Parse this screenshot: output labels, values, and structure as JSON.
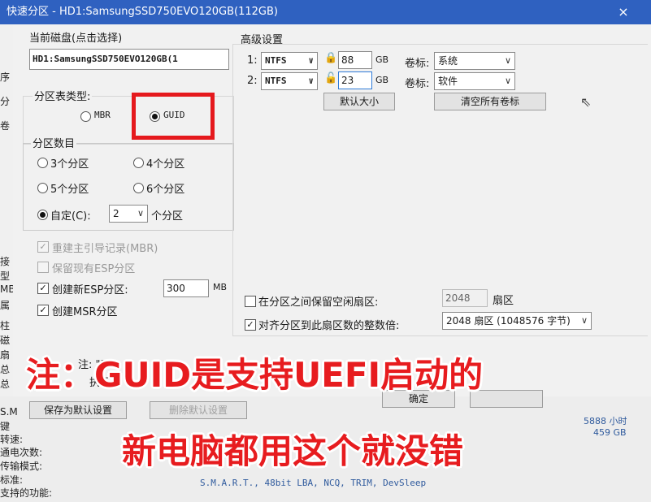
{
  "window": {
    "title": "快速分区 - HD1:SamsungSSD750EVO120GB(112GB)",
    "close_glyph": "×"
  },
  "disk": {
    "label": "当前磁盘(点击选择)",
    "value": "HD1:SamsungSSD750EVO120GB(1"
  },
  "partition_table": {
    "label": "分区表类型:",
    "options": [
      "MBR",
      "GUID"
    ],
    "selected": "GUID"
  },
  "partition_count": {
    "label": "分区数目",
    "options": [
      "3个分区",
      "4个分区",
      "5个分区",
      "6个分区"
    ],
    "custom_label": "自定(C):",
    "custom_value": "2",
    "custom_suffix": "个分区",
    "selected": "custom"
  },
  "options": {
    "rebuild_mbr": "重建主引导记录(MBR)",
    "keep_esp": "保留现有ESP分区",
    "create_esp": "创建新ESP分区:",
    "esp_size": "300",
    "esp_unit": "MB",
    "create_msr": "创建MSR分区"
  },
  "advanced": {
    "label": "高级设置",
    "partitions": [
      {
        "index": "1:",
        "fs": "NTFS",
        "size": "88",
        "unit": "GB",
        "vol_label": "卷标:",
        "volume": "系统"
      },
      {
        "index": "2:",
        "fs": "NTFS",
        "size": "23",
        "unit": "GB",
        "vol_label": "卷标:",
        "volume": "软件"
      }
    ],
    "default_size_button": "默认大小",
    "clear_labels_button": "清空所有卷标",
    "keep_free_label": "在分区之间保留空闲扇区:",
    "keep_free_value": "2048",
    "sector_unit": "扇区",
    "align_label": "对齐分区到此扇区数的整数倍:",
    "align_value": "2048 扇区 (1048576 字节)"
  },
  "footer": {
    "note_fragment": "注: \"3、",
    "note_fragment2": "执行",
    "save_default_button": "保存为默认设置",
    "delete_default_button": "删除默认设置",
    "ok_button": "确定"
  },
  "background": {
    "left_fragments": [
      "序",
      "分",
      "卷",
      "接",
      "型",
      "MB",
      "属",
      "柱",
      "磁",
      "扇",
      "总",
      "总",
      "S.M",
      "键",
      "转速:",
      "通电次数:",
      "传输模式:",
      "标准:",
      "支持的功能:"
    ],
    "hours": "5888 小时",
    "capacity": "459 GB",
    "features": "S.M.A.R.T., 48bit LBA, NCQ, TRIM, DevSleep"
  },
  "annotation": {
    "line1": "注：GUID是支持UEFI启动的",
    "line2": "新电脑都用这个就没错",
    "color": "#e71c1f"
  }
}
